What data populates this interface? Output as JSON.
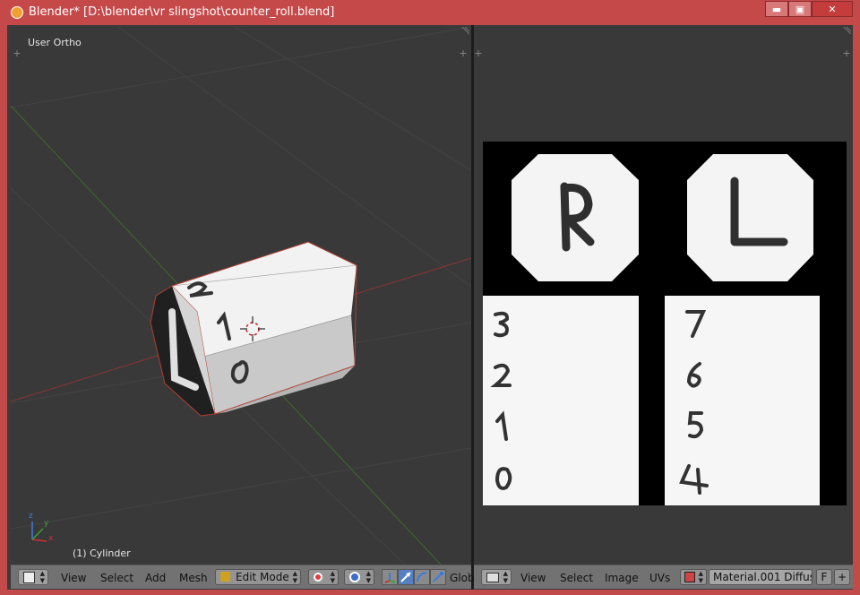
{
  "window": {
    "title": "Blender* [D:\\blender\\vr slingshot\\counter_roll.blend]",
    "min_label": "▬",
    "max_label": "▣",
    "close_label": "✕"
  },
  "view3d": {
    "view_label": "User Ortho",
    "object_label": "(1) Cylinder",
    "axes": {
      "x": "x",
      "y": "y",
      "z": "z"
    },
    "cube_face_labels": {
      "top": "2",
      "middle": "1",
      "bottom": "0",
      "end": "L"
    }
  },
  "header_3d": {
    "menus": [
      "View",
      "Select",
      "Add",
      "Mesh"
    ],
    "mode_label": "Edit Mode",
    "orientation_label": "Glob"
  },
  "uv_editor": {
    "texture_labels": {
      "right_emblem": "R",
      "left_emblem": "L",
      "left_column": [
        "3",
        "2",
        "1",
        "0"
      ],
      "right_column": [
        "7",
        "6",
        "5",
        "4"
      ]
    }
  },
  "header_uv": {
    "menus": [
      "View",
      "Select",
      "Image",
      "UVs"
    ],
    "image_label": "Material.001 Diffus...",
    "fake_user_label": "F"
  },
  "colors": {
    "titlebar": "#c6494a",
    "viewport_bg": "#393939",
    "header_bg": "#727272",
    "active_blue": "#5680c2"
  }
}
